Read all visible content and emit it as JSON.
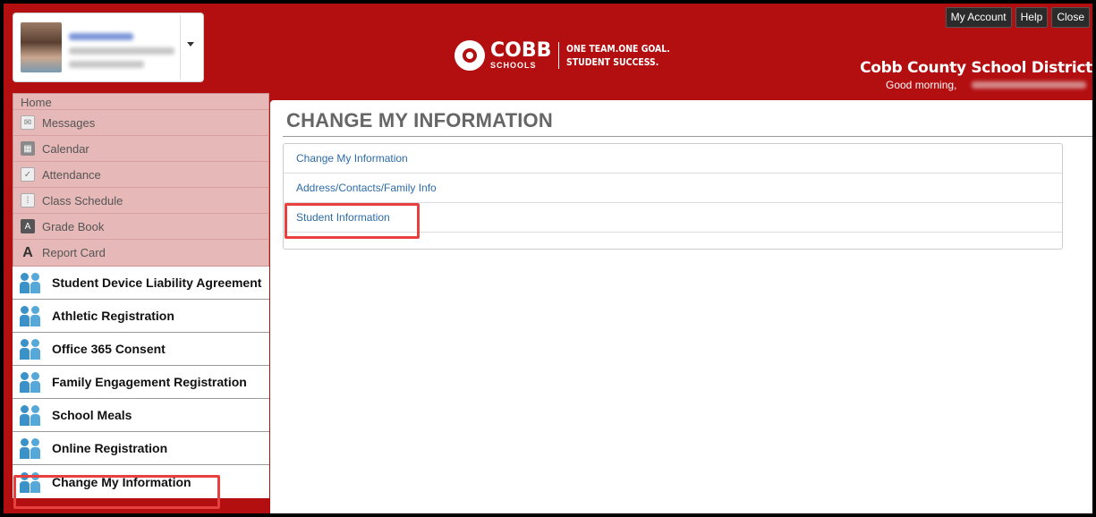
{
  "header": {
    "logo": {
      "cobb": "COBB",
      "schools": "SCHOOLS",
      "tagline_line1": "ONE TEAM.ONE GOAL.",
      "tagline_line2": "STUDENT SUCCESS."
    },
    "buttons": {
      "my_account": "My Account",
      "help": "Help",
      "close": "Close"
    },
    "district_name": "Cobb County School District",
    "greeting": "Good morning,"
  },
  "sidebar": {
    "home_label": "Home",
    "nav_items": [
      {
        "label": "Messages",
        "icon": "envelope-icon"
      },
      {
        "label": "Calendar",
        "icon": "calendar-icon"
      },
      {
        "label": "Attendance",
        "icon": "checkbox-icon"
      },
      {
        "label": "Class Schedule",
        "icon": "schedule-icon"
      },
      {
        "label": "Grade Book",
        "icon": "gradebook-icon"
      },
      {
        "label": "Report Card",
        "icon": "report-card-icon"
      }
    ],
    "form_items": [
      {
        "label": "Student Device Liability Agreement"
      },
      {
        "label": "Athletic Registration"
      },
      {
        "label": "Office 365 Consent"
      },
      {
        "label": "Family Engagement Registration"
      },
      {
        "label": "School Meals"
      },
      {
        "label": "Online Registration"
      },
      {
        "label": "Change My Information"
      }
    ]
  },
  "main": {
    "title": "CHANGE MY INFORMATION",
    "links": [
      {
        "label": "Change My Information"
      },
      {
        "label": "Address/Contacts/Family Info"
      },
      {
        "label": "Student Information"
      }
    ]
  },
  "colors": {
    "header_red": "#b30e10",
    "nav_pink": "#e6b8b8",
    "link_blue": "#2d6ba6",
    "highlight": "#e8403f",
    "icon_blue": "#3a92c9"
  }
}
